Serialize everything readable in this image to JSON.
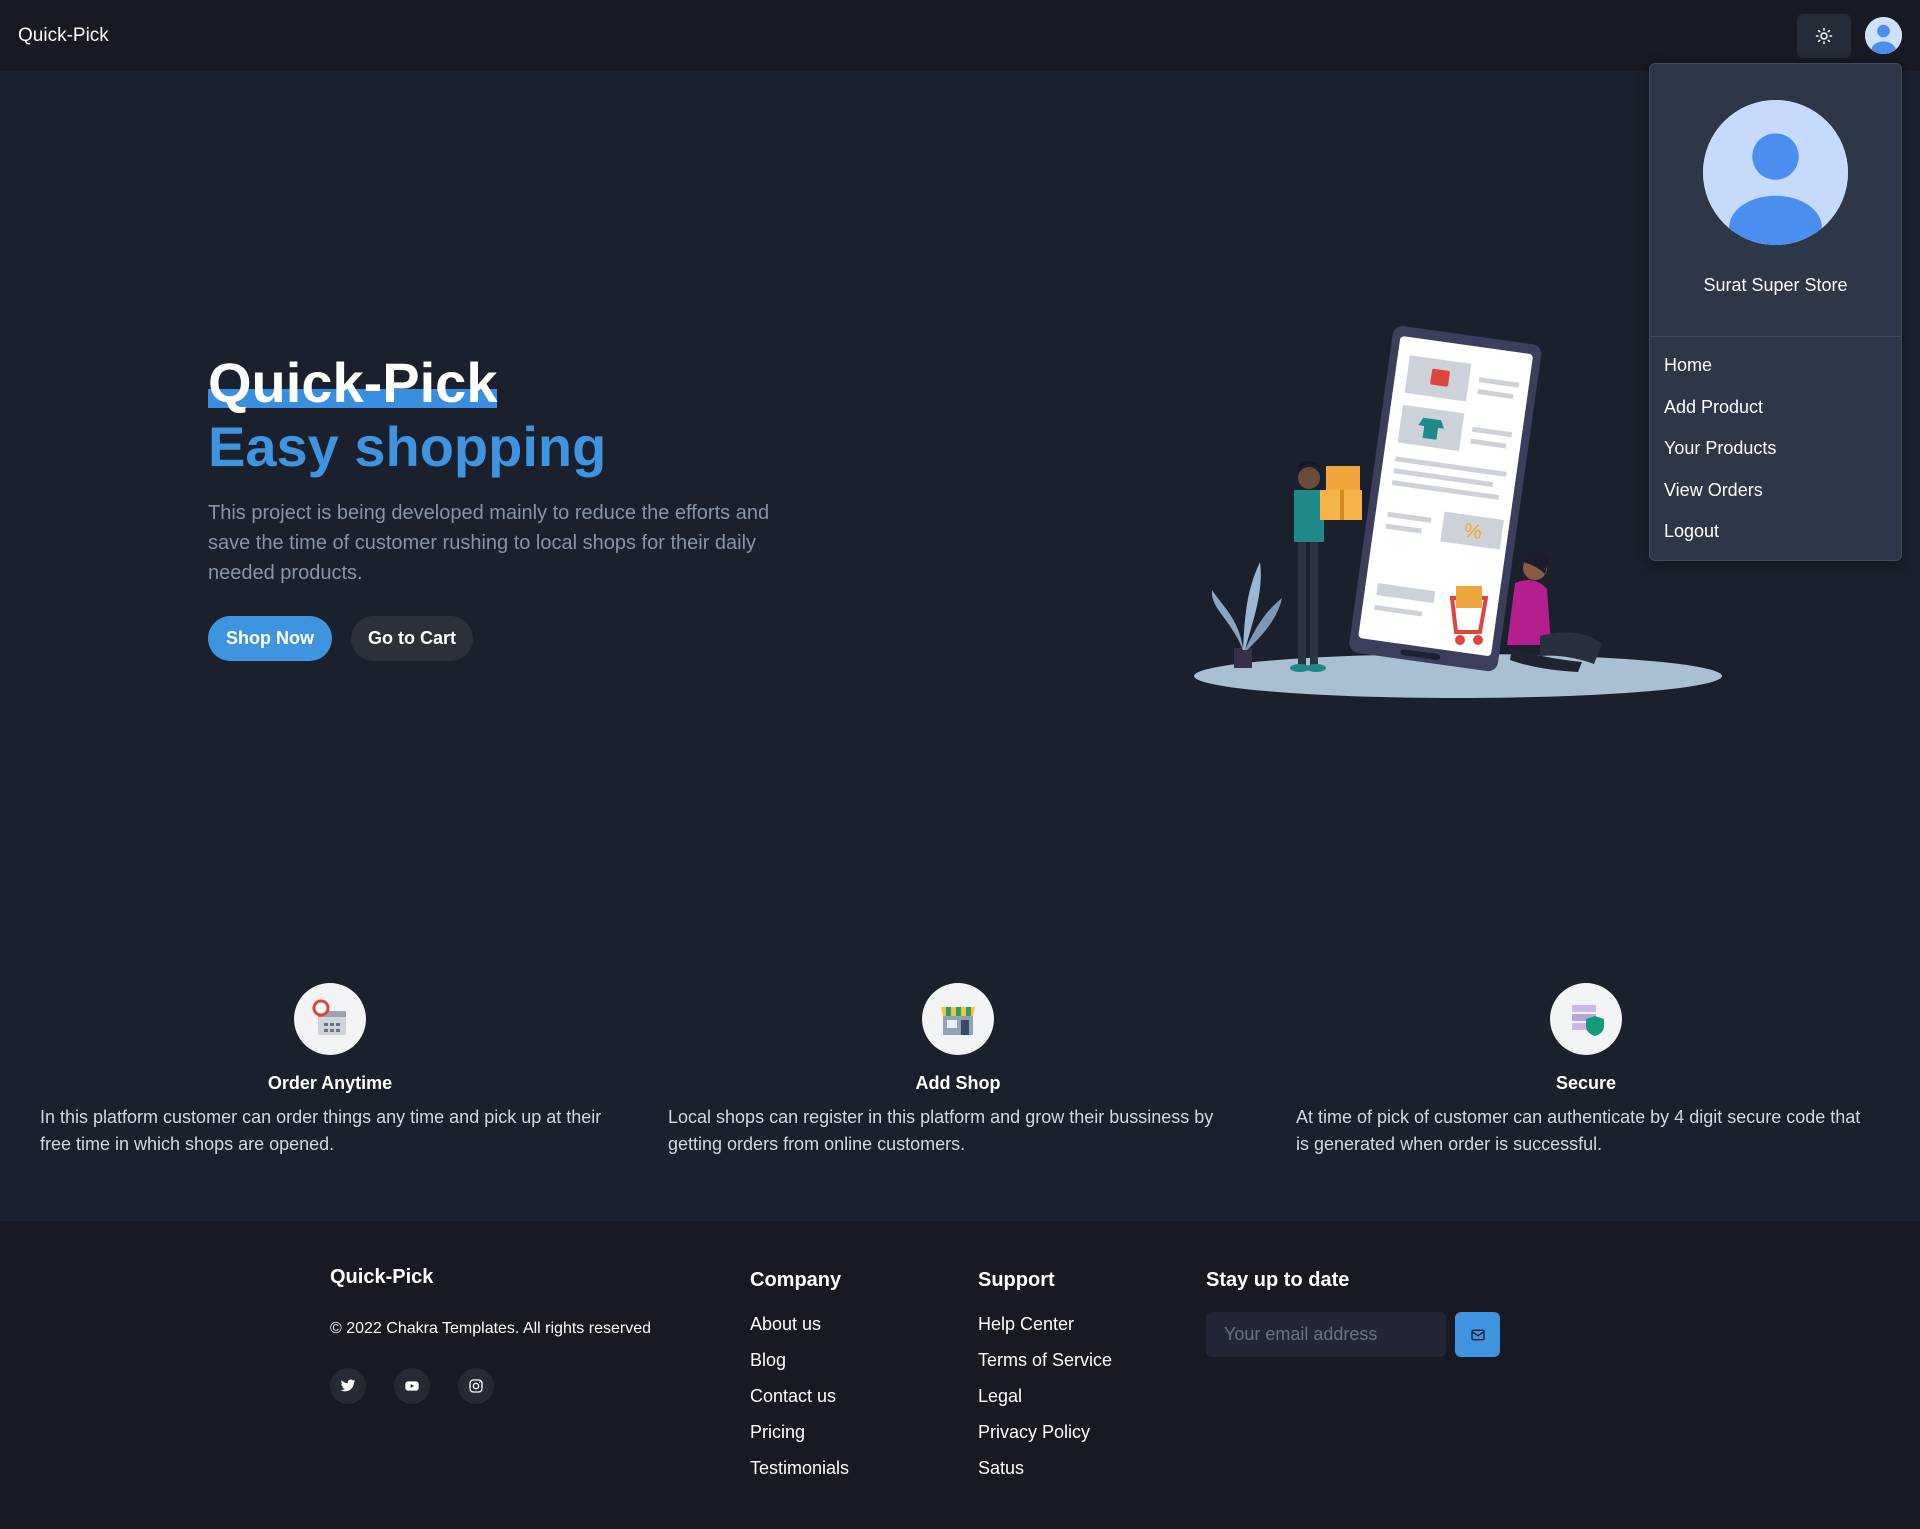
{
  "navbar": {
    "brand": "Quick-Pick",
    "theme_icon": "sun-icon",
    "avatar_icon": "user-avatar-icon"
  },
  "menu": {
    "store_name": "Surat Super Store",
    "items": [
      {
        "label": "Home"
      },
      {
        "label": "Add Product"
      },
      {
        "label": "Your Products"
      },
      {
        "label": "View Orders"
      },
      {
        "label": "Logout"
      }
    ]
  },
  "hero": {
    "title": "Quick-Pick",
    "subtitle": "Easy shopping",
    "description": "This project is being developed mainly to reduce the efforts and save the time of customer rushing to local shops for their daily needed products.",
    "primary_button": "Shop Now",
    "secondary_button": "Go to Cart"
  },
  "features": [
    {
      "icon": "calendar-clock-icon",
      "title": "Order Anytime",
      "description": "In this platform customer can order things any time and pick up at their free time in which shops are opened."
    },
    {
      "icon": "shop-icon",
      "title": "Add Shop",
      "description": "Local shops can register in this platform and grow their bussiness by getting orders from online customers."
    },
    {
      "icon": "secure-server-icon",
      "title": "Secure",
      "description": "At time of pick of customer can authenticate by 4 digit secure code that is generated when order is successful."
    }
  ],
  "footer": {
    "brand": "Quick-Pick",
    "copyright": "© 2022 Chakra Templates. All rights reserved",
    "socials": [
      "twitter-icon",
      "youtube-icon",
      "instagram-icon"
    ],
    "company": {
      "title": "Company",
      "links": [
        "About us",
        "Blog",
        "Contact us",
        "Pricing",
        "Testimonials"
      ]
    },
    "support": {
      "title": "Support",
      "links": [
        "Help Center",
        "Terms of Service",
        "Legal",
        "Privacy Policy",
        "Satus"
      ]
    },
    "newsletter": {
      "title": "Stay up to date",
      "placeholder": "Your email address",
      "button_icon": "send-mail-icon"
    }
  },
  "colors": {
    "background": "#1a202c",
    "navbar": "#171923",
    "accent": "#3f94e0",
    "menu": "#2d3748"
  }
}
